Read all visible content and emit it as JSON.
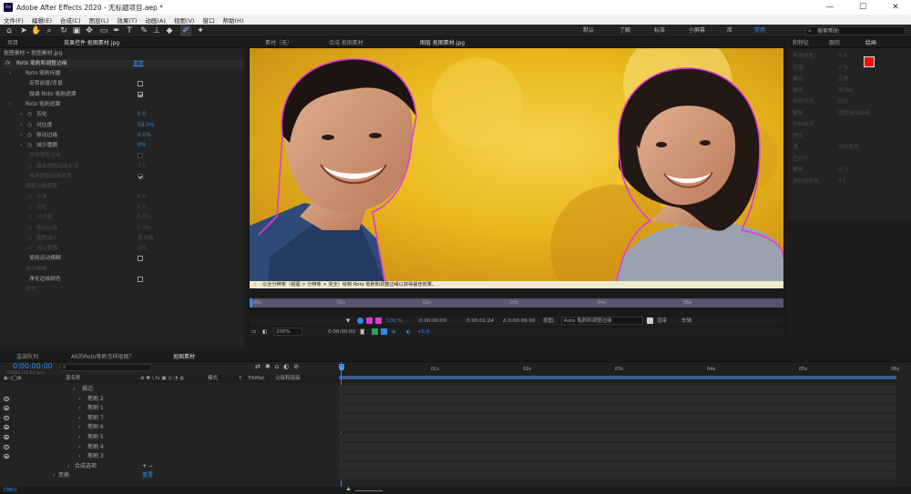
{
  "app": {
    "title": "Adobe After Effects 2020 - 无标题项目.aep *",
    "logo": "Ae",
    "window_controls": [
      "—",
      "☐",
      "✕"
    ]
  },
  "menu": [
    "文件(F)",
    "编辑(E)",
    "合成(C)",
    "图层(L)",
    "效果(T)",
    "动画(A)",
    "视图(V)",
    "窗口",
    "帮助(H)"
  ],
  "workspaces": [
    "默认",
    "了解",
    "标准",
    "小屏幕",
    "库",
    "常用"
  ],
  "active_workspace": "常用",
  "search_help": "搜索帮助",
  "left_panel": {
    "tabs": [
      "项目",
      "效果控件 抠图素材.jpg"
    ],
    "layer_path": "抠图素材 • 抠图素材.jpg",
    "effect_name": "Roto 笔刷和调整边缘",
    "reset_label": "重置",
    "rows": [
      {
        "label": "Roto 笔刷传播",
        "type": "group"
      },
      {
        "label": "反转前景/背景",
        "type": "check",
        "on": false
      },
      {
        "label": "微调 Roto 笔刷遮罩",
        "type": "check",
        "on": true
      },
      {
        "label": "Roto 笔刷遮罩",
        "type": "group"
      },
      {
        "label": "羽化",
        "type": "value",
        "value": "0.0"
      },
      {
        "label": "对比度",
        "type": "value",
        "value": "50.0%"
      },
      {
        "label": "移动边缘",
        "type": "value",
        "value": "0.0%"
      },
      {
        "label": "减少震颤",
        "type": "value",
        "value": "0%"
      },
      {
        "label": "添加调整边缘",
        "type": "check",
        "on": false,
        "dim": true
      },
      {
        "label": "基本调整边缘半径",
        "type": "dimvalue",
        "value": "3.0",
        "dim": true
      },
      {
        "label": "微调调整边缘遮罩",
        "type": "check",
        "on": true,
        "dim": true
      },
      {
        "label": "调整边缘遮罩",
        "type": "dimgroup",
        "dim": true
      },
      {
        "label": "平滑",
        "type": "dimvalue",
        "value": "0.0",
        "dim": true
      },
      {
        "label": "羽化",
        "type": "dimvalue",
        "value": "0.0",
        "dim": true
      },
      {
        "label": "对比度",
        "type": "dimvalue",
        "value": "0.0%",
        "dim": true
      },
      {
        "label": "移动边缘",
        "type": "dimvalue",
        "value": "0.0%",
        "dim": true
      },
      {
        "label": "震颤减少",
        "type": "dimvalue",
        "value": "更详细",
        "dim": true
      },
      {
        "label": "减少震颤",
        "type": "dimvalue",
        "value": "0%",
        "dim": true
      },
      {
        "label": "使用运动模糊",
        "type": "check",
        "on": false
      },
      {
        "label": "运动模糊",
        "type": "dimgroup",
        "dim": true
      },
      {
        "label": "净化边缘颜色",
        "type": "check",
        "on": false
      },
      {
        "label": "净化",
        "type": "dimgroup",
        "dim": true
      }
    ]
  },
  "viewer": {
    "tabs": [
      "素材（无）",
      "合成 抠图素材",
      "图层 抠图素材.jpg"
    ],
    "active_tab": "图层 抠图素材.jpg",
    "status_msg": "以全分辨率（视图 > 分辨率 > 完全）绘制 Roto 笔刷和调整边缘以获得最佳效果。",
    "ruler": [
      "00s",
      "01s",
      "02s",
      "03s",
      "04s",
      "05s"
    ],
    "zoom_pct": "100 %",
    "time_a": "0:00:00:00",
    "time_b": "0:00:01:24",
    "time_c": "Δ 0:00:06:00",
    "view_label": "视图：",
    "view_value": "Roto 笔刷和调整边缘",
    "render_label": "渲染",
    "toggle_label": "车辑",
    "zoom_select": "200%",
    "timecode": "0:00:00:00",
    "exposure": "+0.0"
  },
  "right_panel": {
    "tabs": [
      "和特征",
      "跟踪",
      "绘画"
    ],
    "rows": [
      "不透明度：",
      "流量：",
      "模式",
      "通道",
      "持续时间",
      "擦除",
      "仿制选项",
      "预设",
      "源",
      "已对齐",
      "偏移",
      "源时间转移"
    ],
    "values": [
      "0 %",
      "0 %",
      "正常",
      "RGBA",
      "固定",
      "图层源和绘画",
      "",
      "",
      "当前图层",
      "",
      "0, 0",
      "0 f"
    ]
  },
  "timeline": {
    "tabs": [
      "渲染队列",
      "AE的Roto笔刷怎样抠图？",
      "抠图素材"
    ],
    "timecode": "0:00:00:00",
    "subcode": "00000 (25.00 fps)",
    "columns": [
      "源名称",
      "模式",
      "T",
      "TrkMat",
      "父级和链接"
    ],
    "layers": [
      "描边",
      "笔刷 2",
      "笔刷 1",
      "笔刷 7",
      "笔刷 6",
      "笔刷 5",
      "笔刷 4",
      "笔刷 3"
    ],
    "footer": [
      "合成选项",
      "变换"
    ],
    "footer_value": "重置",
    "ruler": [
      "0s",
      "01s",
      "02s",
      "03s",
      "04s",
      "05s",
      "06s"
    ]
  }
}
